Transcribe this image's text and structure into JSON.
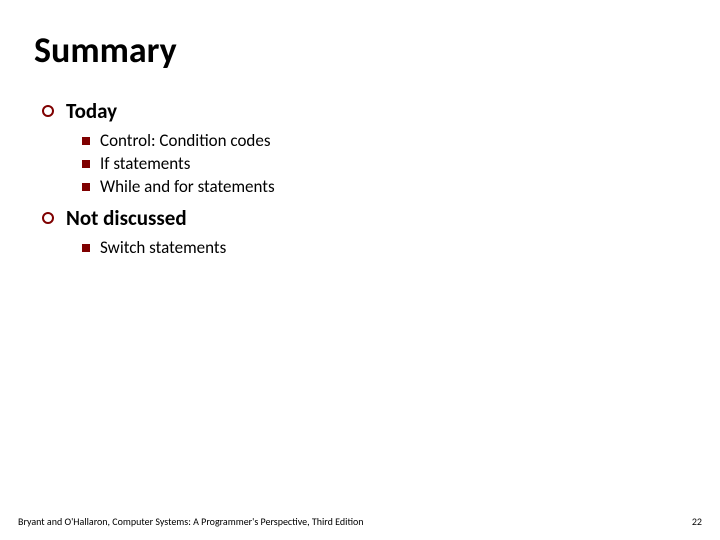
{
  "title": "Summary",
  "sections": [
    {
      "heading": "Today",
      "items": [
        "Control: Condition codes",
        "If statements",
        "While and for statements"
      ]
    },
    {
      "heading": "Not discussed",
      "items": [
        "Switch statements"
      ]
    }
  ],
  "footer": {
    "left": "Bryant and O'Hallaron, Computer Systems: A Programmer's Perspective, Third Edition",
    "right": "22"
  }
}
